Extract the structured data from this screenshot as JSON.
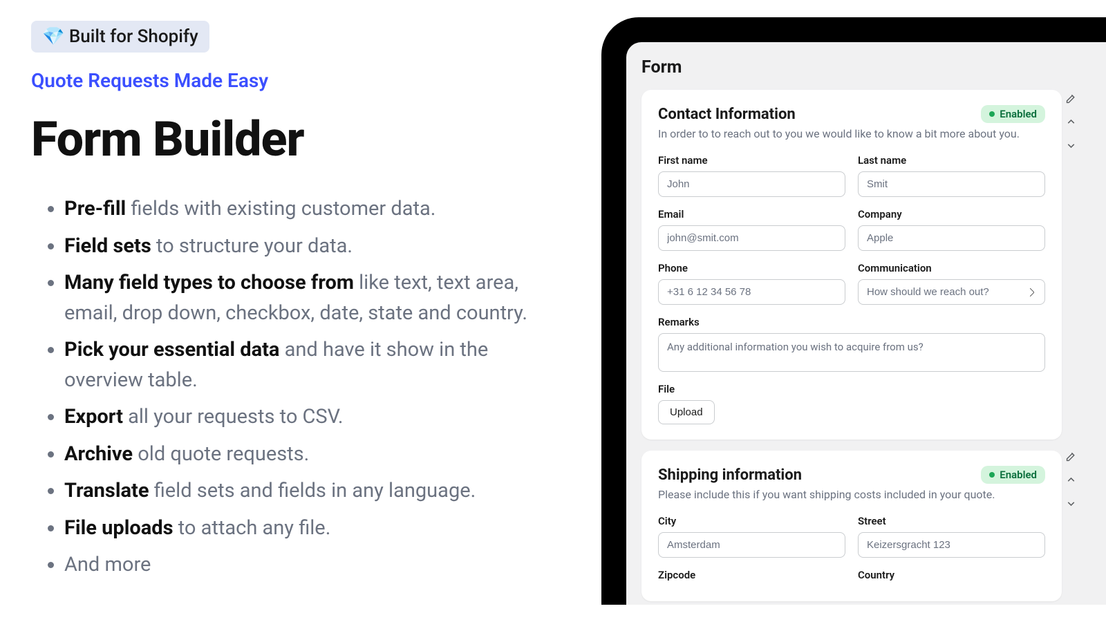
{
  "left": {
    "badge": "💎 Built for Shopify",
    "subtitle": "Quote Requests Made Easy",
    "title": "Form Builder",
    "features": [
      {
        "bold": "Pre-fill",
        "rest": " fields with existing customer data."
      },
      {
        "bold": "Field sets",
        "rest": " to structure your data."
      },
      {
        "bold": "Many field types to choose from",
        "rest": " like text, text area, email, drop down, checkbox, date, state and country."
      },
      {
        "bold": "Pick your essential data",
        "rest": " and have it show in the overview table."
      },
      {
        "bold": "Export",
        "rest": " all your requests to CSV."
      },
      {
        "bold": "Archive",
        "rest": " old quote requests."
      },
      {
        "bold": "Translate",
        "rest": " field sets and fields in any language."
      },
      {
        "bold": "File uploads",
        "rest": " to attach any file."
      },
      {
        "bold": "",
        "rest": "And more"
      }
    ]
  },
  "screen": {
    "title": "Form",
    "card1": {
      "title": "Contact Information",
      "status": "Enabled",
      "desc": "In order to to reach out to you we would like to know a bit more about you.",
      "firstname_label": "First name",
      "firstname_ph": "John",
      "lastname_label": "Last name",
      "lastname_ph": "Smit",
      "email_label": "Email",
      "email_ph": "john@smit.com",
      "company_label": "Company",
      "company_ph": "Apple",
      "phone_label": "Phone",
      "phone_ph": "+31 6 12 34 56 78",
      "comm_label": "Communication",
      "comm_ph": "How should we reach out?",
      "remarks_label": "Remarks",
      "remarks_ph": "Any additional information you wish to acquire from us?",
      "file_label": "File",
      "upload_btn": "Upload"
    },
    "card2": {
      "title": "Shipping information",
      "status": "Enabled",
      "desc": "Please include this if you want shipping costs included in your quote.",
      "city_label": "City",
      "city_ph": "Amsterdam",
      "street_label": "Street",
      "street_ph": "Keizersgracht 123",
      "zip_label": "Zipcode",
      "country_label": "Country"
    }
  }
}
